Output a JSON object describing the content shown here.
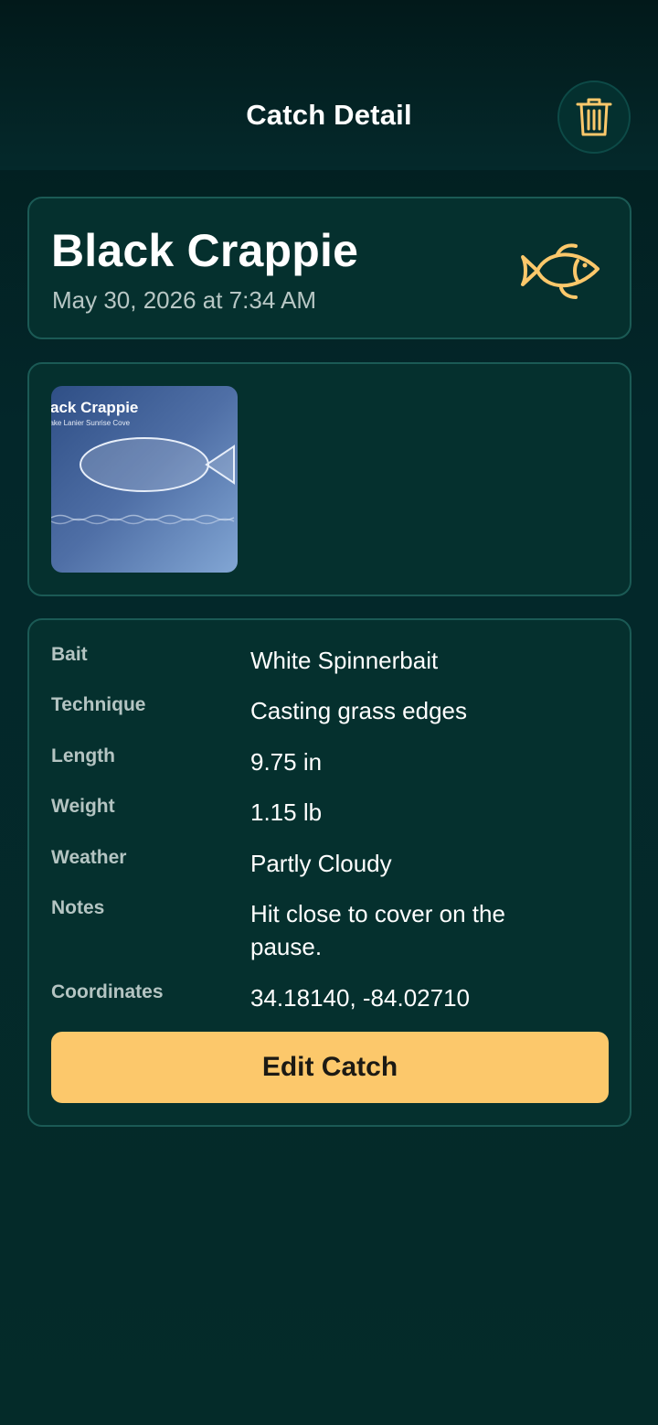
{
  "header": {
    "title": "Catch Detail",
    "delete_icon": "trash-icon"
  },
  "catch": {
    "species": "Black Crappie",
    "date": "May 30, 2026 at 7:34 AM",
    "species_icon": "fish-icon"
  },
  "photo": {
    "title": "Black Crappie",
    "subtitle": "Lake Lanier Sunrise Cove"
  },
  "details": {
    "rows": [
      {
        "label": "Bait",
        "value": "White Spinnerbait"
      },
      {
        "label": "Technique",
        "value": "Casting grass edges"
      },
      {
        "label": "Length",
        "value": "9.75 in"
      },
      {
        "label": "Weight",
        "value": "1.15 lb"
      },
      {
        "label": "Weather",
        "value": "Partly Cloudy"
      },
      {
        "label": "Notes",
        "value": "Hit close to cover on the pause."
      },
      {
        "label": "Coordinates",
        "value": "34.18140, -84.02710"
      }
    ],
    "edit_label": "Edit Catch"
  },
  "colors": {
    "accent": "#fcc86b",
    "background": "#042a28",
    "card": "#05302e",
    "card_border": "#1b5a55"
  }
}
